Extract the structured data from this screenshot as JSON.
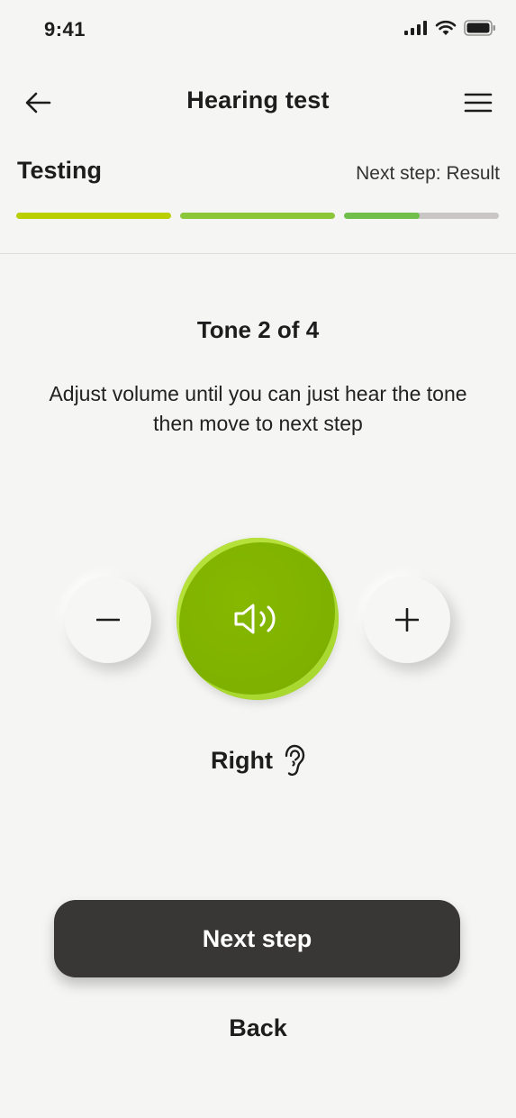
{
  "status_bar": {
    "time": "9:41"
  },
  "nav": {
    "title": "Hearing test"
  },
  "progress": {
    "step_title": "Testing",
    "next_step": "Next step: Result",
    "segments": [
      {
        "fill": 1.0,
        "color": "#b9cf00"
      },
      {
        "fill": 1.0,
        "color": "#8cc63a"
      },
      {
        "fill": 0.49,
        "color": "#6fbf4a"
      }
    ]
  },
  "main": {
    "tone_label": "Tone 2 of 4",
    "instruction": "Adjust volume until you can just hear the tone then move to next step",
    "ear_label": "Right"
  },
  "buttons": {
    "next": "Next step",
    "back": "Back"
  },
  "icons": {
    "back": "arrow-left-icon",
    "menu": "hamburger-menu-icon",
    "volume_down": "minus-icon",
    "volume_up": "plus-icon",
    "play": "speaker-icon",
    "ear": "ear-icon"
  },
  "colors": {
    "accent": "#7fb200",
    "primary_button": "#383736"
  }
}
